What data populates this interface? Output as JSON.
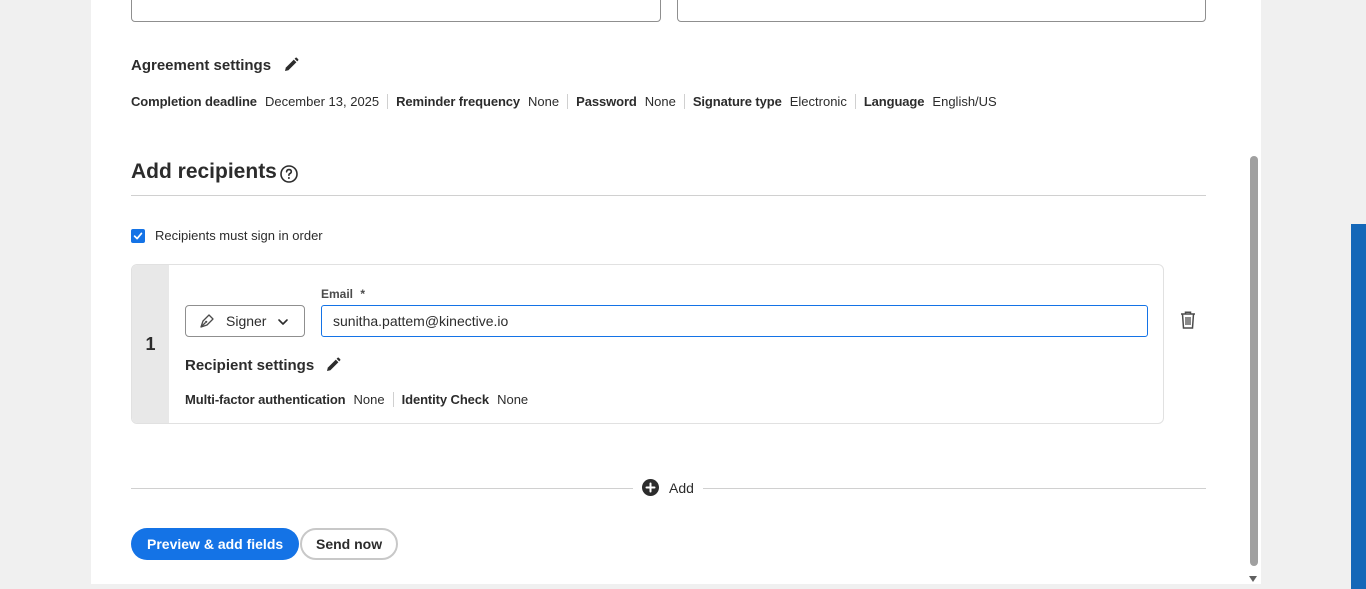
{
  "agreement_settings": {
    "title": "Agreement settings",
    "items": [
      {
        "label": "Completion deadline",
        "value": "December 13, 2025"
      },
      {
        "label": "Reminder frequency",
        "value": "None"
      },
      {
        "label": "Password",
        "value": "None"
      },
      {
        "label": "Signature type",
        "value": "Electronic"
      },
      {
        "label": "Language",
        "value": "English/US"
      }
    ]
  },
  "recipients": {
    "title": "Add recipients",
    "sign_in_order_label": "Recipients must sign in order",
    "sign_in_order_checked": true,
    "list": [
      {
        "order": "1",
        "role": "Signer",
        "email_label": "Email",
        "email_required_mark": "*",
        "email": "sunitha.pattem@kinective.io",
        "settings_title": "Recipient settings",
        "settings": [
          {
            "label": "Multi-factor authentication",
            "value": "None"
          },
          {
            "label": "Identity Check",
            "value": "None"
          }
        ]
      }
    ],
    "add_label": "Add"
  },
  "actions": {
    "preview_label": "Preview & add fields",
    "send_label": "Send now"
  },
  "colors": {
    "accent": "#1473e6",
    "sidebar_bar": "#1467b8"
  }
}
